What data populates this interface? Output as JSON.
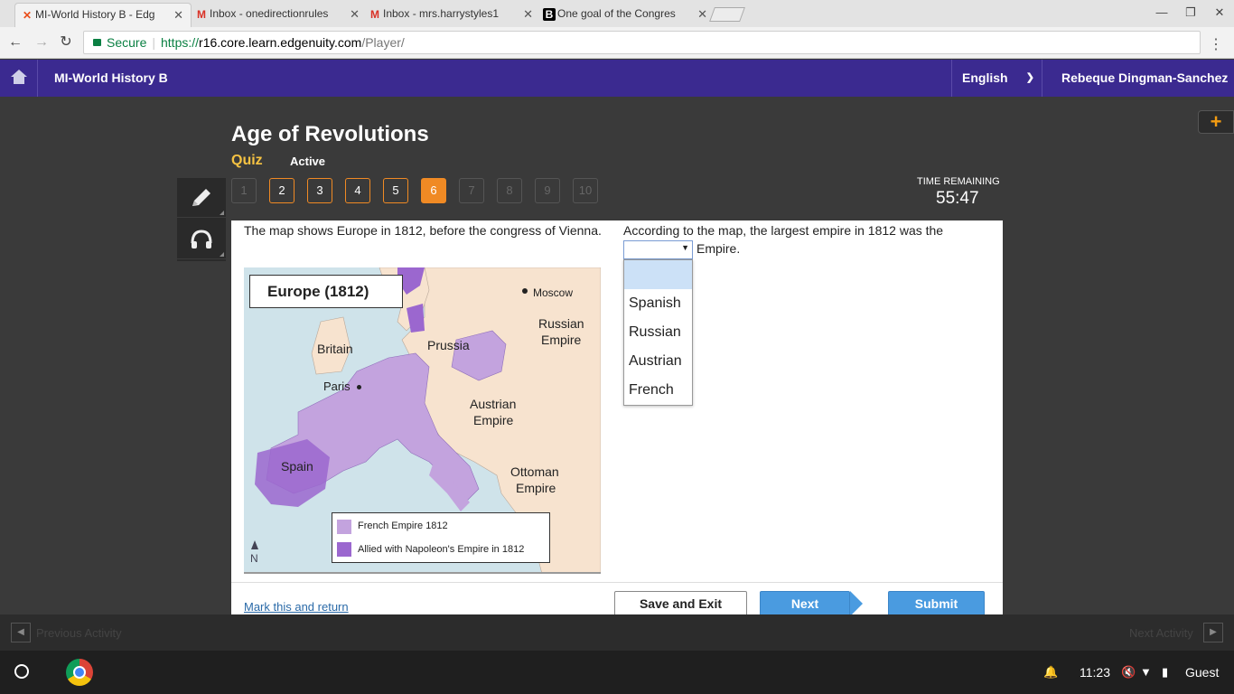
{
  "browser": {
    "tabs": [
      {
        "title": "MI-World History B - Edg",
        "icon": "edgenuity-x-icon"
      },
      {
        "title": "Inbox - onedirectionrules",
        "icon": "gmail-icon"
      },
      {
        "title": "Inbox - mrs.harrystyles1",
        "icon": "gmail-icon"
      },
      {
        "title": "One goal of the Congres",
        "icon": "brainly-icon"
      }
    ],
    "secure_label": "Secure",
    "url_scheme": "https://",
    "url_host": "r16.core.learn.edgenuity.com",
    "url_path": "/Player/"
  },
  "header": {
    "course": "MI-World History B",
    "language": "English",
    "user": "Rebeque Dingman-Sanchez"
  },
  "page": {
    "title": "Age of Revolutions",
    "type": "Quiz",
    "status": "Active",
    "questions": [
      "1",
      "2",
      "3",
      "4",
      "5",
      "6",
      "7",
      "8",
      "9",
      "10"
    ],
    "answered": [
      2,
      3,
      4,
      5
    ],
    "current": 6,
    "time_label": "TIME REMAINING",
    "time_value": "55:47"
  },
  "content": {
    "prompt": "The map shows Europe in 1812, before the congress of Vienna.",
    "map": {
      "title": "Europe  (1812)",
      "labels": {
        "moscow": "Moscow",
        "russian": "Russian",
        "russian2": "Empire",
        "britain": "Britain",
        "prussia": "Prussia",
        "paris": "Paris",
        "austrian": "Austrian",
        "austrian2": "Empire",
        "spain": "Spain",
        "ottoman": "Ottoman",
        "ottoman2": "Empire",
        "north": "N"
      },
      "legend": [
        "French Empire 1812",
        "Allied with Napoleon's Empire in 1812"
      ],
      "colors": {
        "french": "#c3a3de",
        "allied": "#9b67cf",
        "land": "#f7e3cf",
        "sea": "#cfe3ea"
      }
    },
    "question": "According to the map, the largest empire in 1812 was the",
    "question_after": "Empire.",
    "dropdown": {
      "selected": "",
      "options": [
        "",
        "Spanish",
        "Russian",
        "Austrian",
        "French"
      ]
    }
  },
  "footer": {
    "mark": "Mark this and return",
    "save": "Save and Exit",
    "next": "Next",
    "submit": "Submit"
  },
  "activity": {
    "prev": "Previous Activity",
    "next": "Next Activity"
  },
  "shelf": {
    "time": "11:23",
    "user": "Guest"
  }
}
